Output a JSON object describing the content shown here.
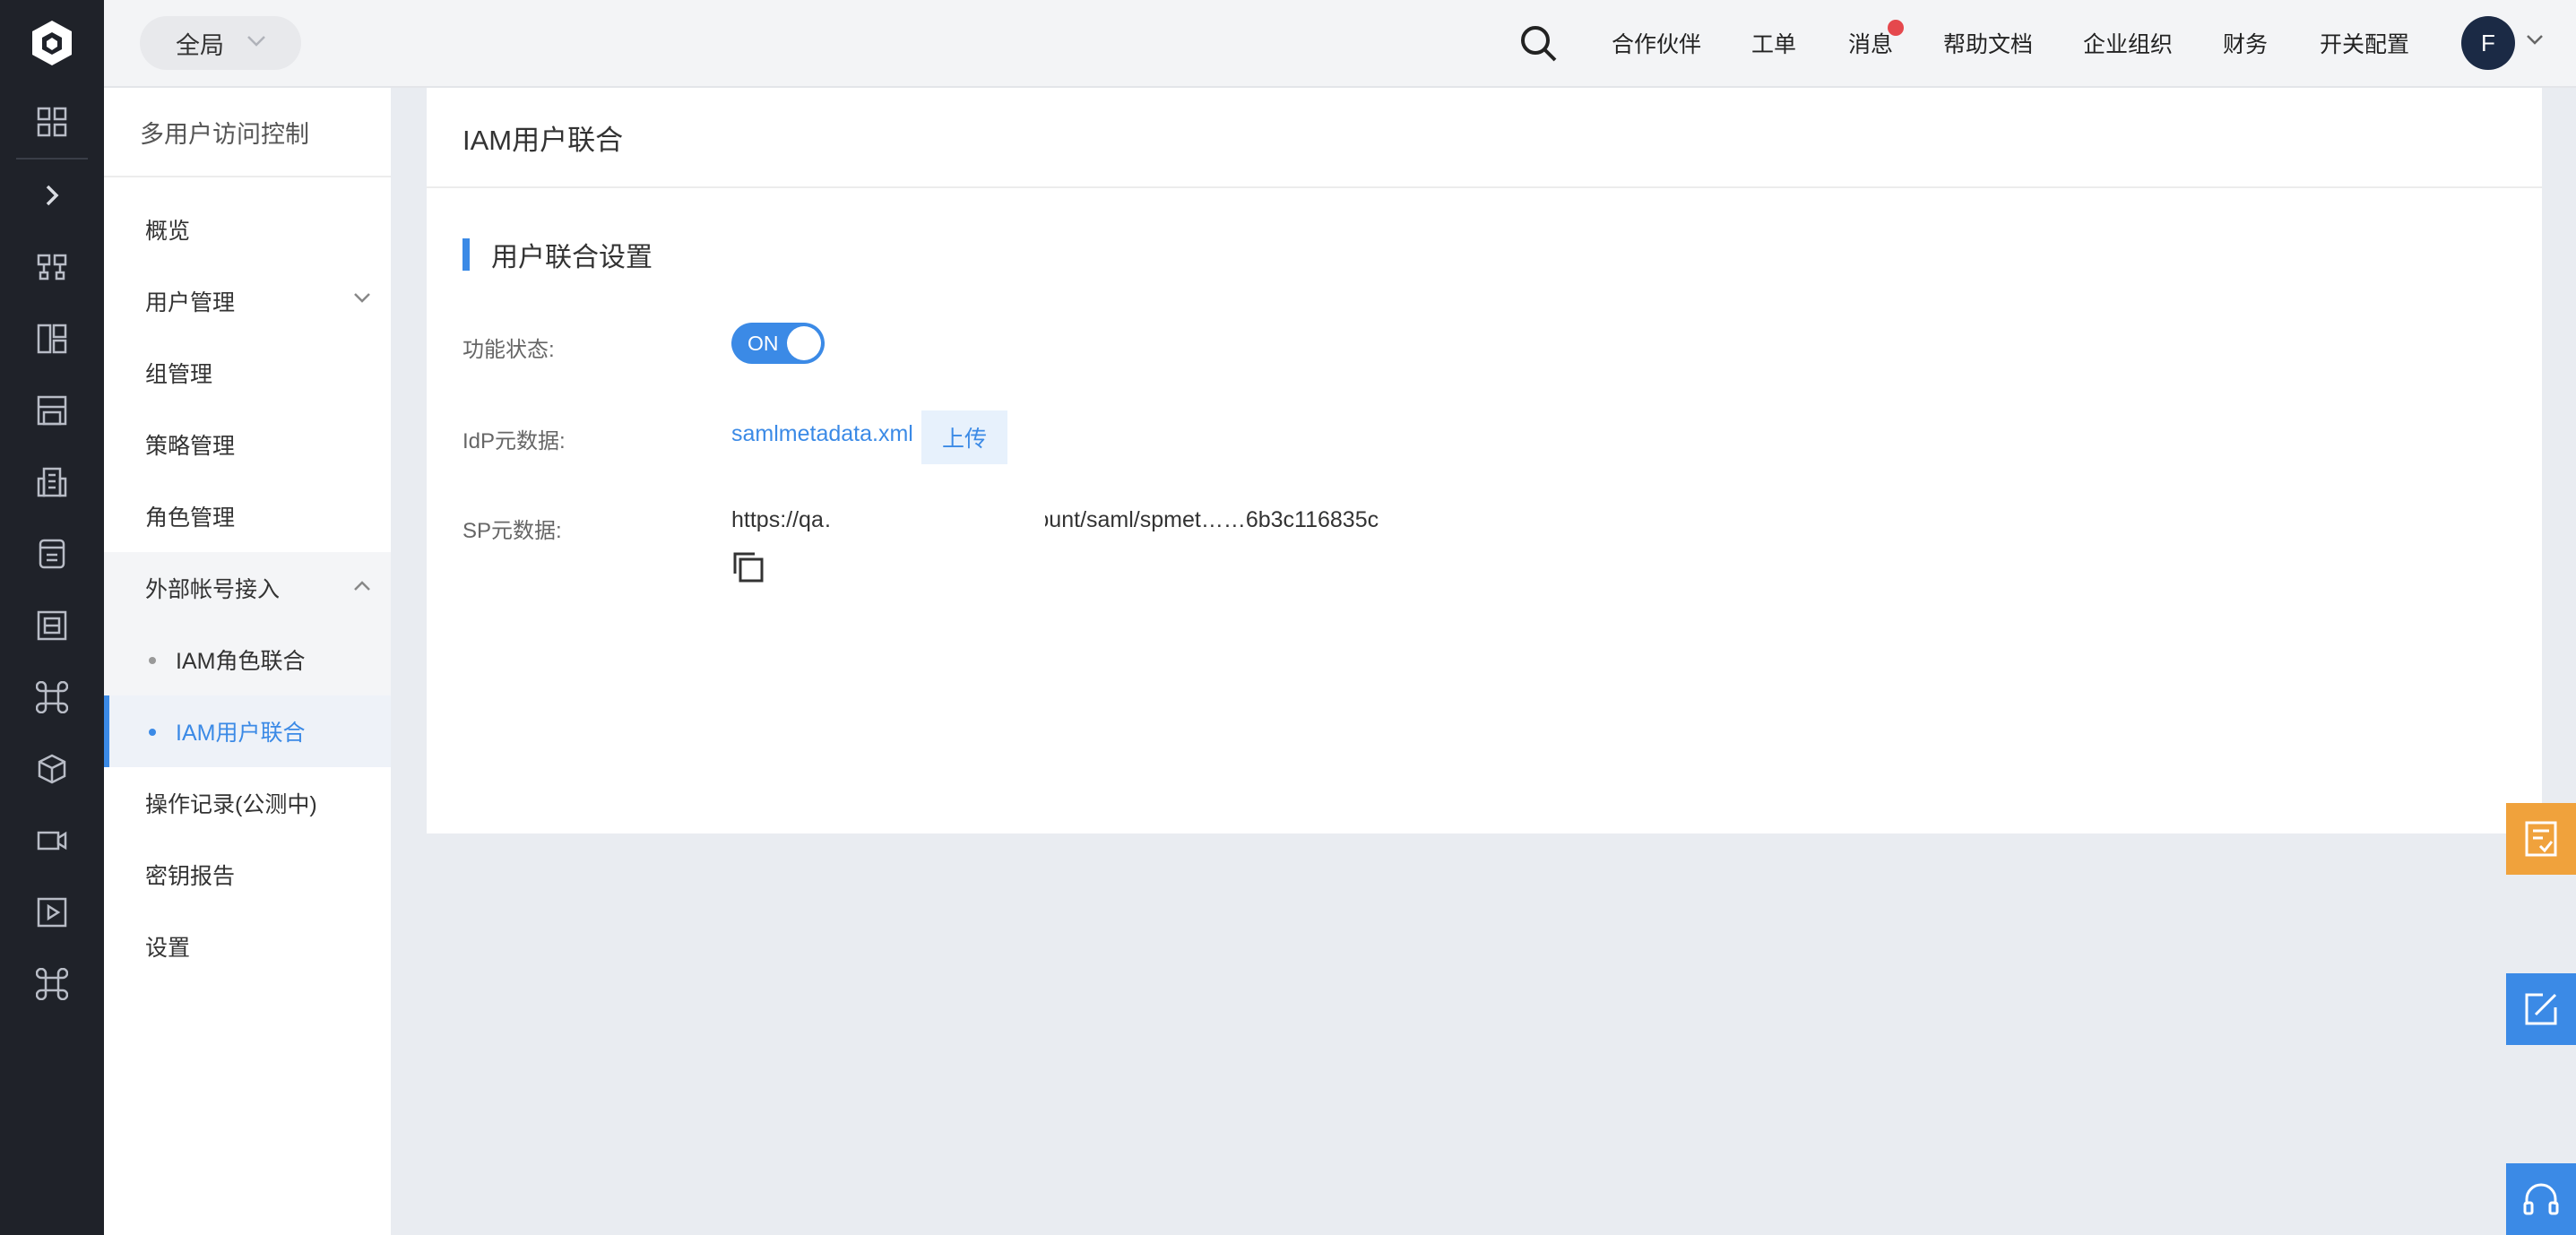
{
  "header": {
    "scope": "全局",
    "nav": [
      "合作伙伴",
      "工单",
      "消息",
      "帮助文档",
      "企业组织",
      "财务",
      "开关配置"
    ],
    "avatar_letter": "F"
  },
  "sidebar": {
    "title": "多用户访问控制",
    "items": [
      {
        "label": "概览"
      },
      {
        "label": "用户管理"
      },
      {
        "label": "组管理"
      },
      {
        "label": "策略管理"
      },
      {
        "label": "角色管理"
      },
      {
        "label": "外部帐号接入"
      }
    ],
    "sub_items": [
      {
        "label": "IAM角色联合",
        "active": false
      },
      {
        "label": "IAM用户联合",
        "active": true
      }
    ],
    "bottom_items": [
      {
        "label": "操作记录(公测中)"
      },
      {
        "label": "密钥报告"
      },
      {
        "label": "设置"
      }
    ]
  },
  "main": {
    "page_title": "IAM用户联合",
    "section_title": "用户联合设置",
    "status_label": "功能状态:",
    "toggle_text": "ON",
    "idp_label": "IdP元数据:",
    "idp_file": "samlmetadata.xml",
    "upload_label": "上传",
    "sp_label": "SP元数据:",
    "sp_url": "https://qa…….com/api/iam/account/saml/spmet……6b3c116835c"
  },
  "colors": {
    "rail": "#1f2229",
    "accent": "#3b8ae6",
    "float_orange": "#f0a23c",
    "float_blue": "#3b8ae6",
    "badge_red": "#e5484d"
  },
  "icons": {
    "rail": [
      "logo-icon",
      "grid-icon",
      "expand-icon",
      "topology-icon",
      "dashboard-icon",
      "storage-icon",
      "building-icon",
      "database-icon",
      "server-icon",
      "command-icon",
      "package-icon",
      "video-icon",
      "play-icon",
      "command-icon"
    ],
    "float": [
      "checklist-icon",
      "edit-icon",
      "headset-icon"
    ]
  }
}
